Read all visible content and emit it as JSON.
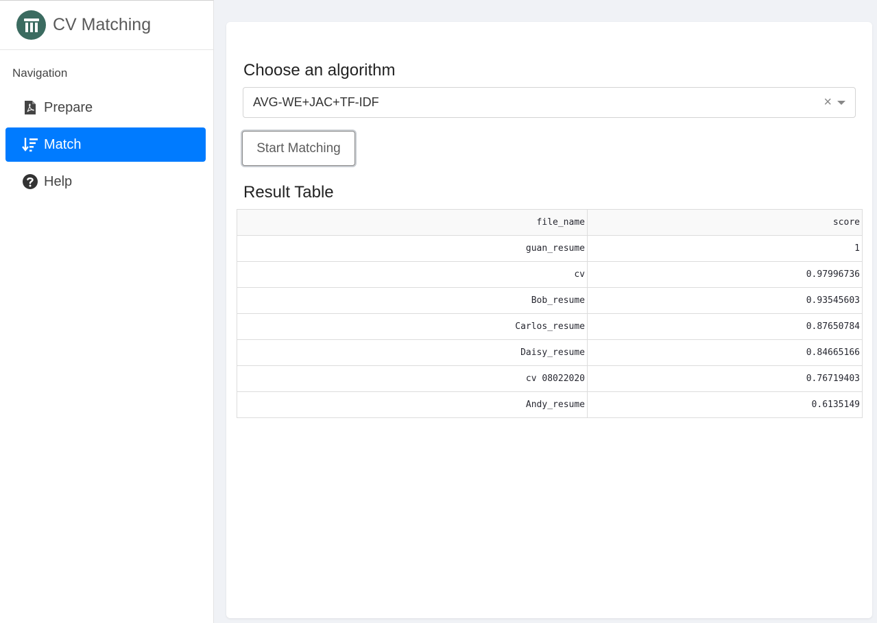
{
  "app": {
    "title": "CV Matching"
  },
  "sidebar": {
    "header": "Navigation",
    "items": [
      {
        "label": "Prepare",
        "icon": "file-pdf-icon",
        "active": false
      },
      {
        "label": "Match",
        "icon": "sort-amount-down-icon",
        "active": true
      },
      {
        "label": "Help",
        "icon": "question-circle-icon",
        "active": false
      }
    ]
  },
  "main": {
    "algorithm_heading": "Choose an algorithm",
    "algorithm_selected": "AVG-WE+JAC+TF-IDF",
    "clear_symbol": "×",
    "start_button": "Start Matching",
    "result_heading": "Result Table",
    "table": {
      "columns": [
        "file_name",
        "score"
      ],
      "rows": [
        [
          "guan_resume",
          "1"
        ],
        [
          "cv",
          "0.97996736"
        ],
        [
          "Bob_resume",
          "0.93545603"
        ],
        [
          "Carlos_resume",
          "0.87650784"
        ],
        [
          "Daisy_resume",
          "0.84665166"
        ],
        [
          "cv 08022020",
          "0.76719403"
        ],
        [
          "Andy_resume",
          "0.6135149"
        ]
      ]
    }
  },
  "colors": {
    "accent": "#007bff",
    "logo": "#3b6b60"
  }
}
